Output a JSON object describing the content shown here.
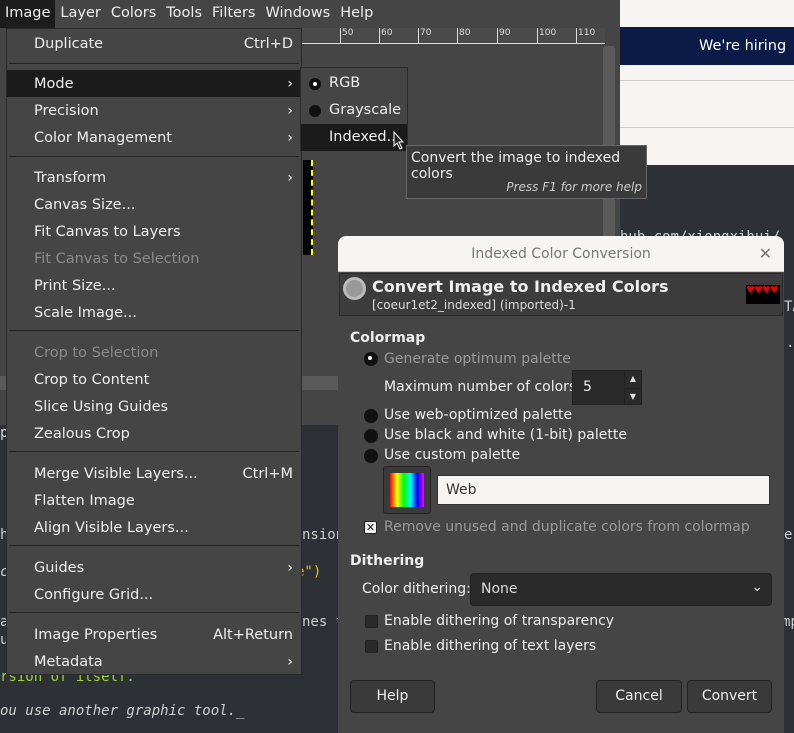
{
  "menubar": [
    "Image",
    "Layer",
    "Colors",
    "Tools",
    "Filters",
    "Windows",
    "Help"
  ],
  "ruler": [
    "50",
    "60",
    "70",
    "80",
    "90",
    "100",
    "110"
  ],
  "browser": {
    "banner": "We're hiring"
  },
  "background_code": {
    "l1": "hub.com/xiongxihui/",
    "l2": "TA",
    "l3": ".",
    "l4": "p",
    "l5": "h",
    "l6": "nsion",
    "l7": "c",
    "l8": "e\")",
    "l9": "a",
    "l10": "nes t",
    "l11": "u",
    "l12": "rsion of itself.",
    "l13": "ou use another graphic tool._",
    "l14": "e",
    "l15": "mp"
  },
  "image_menu": [
    {
      "label": "Duplicate",
      "shortcut": "Ctrl+D"
    },
    {
      "label": "Mode"
    },
    {
      "label": "Precision"
    },
    {
      "label": "Color Management"
    },
    {
      "label": "Transform"
    },
    {
      "label": "Canvas Size..."
    },
    {
      "label": "Fit Canvas to Layers"
    },
    {
      "label": "Fit Canvas to Selection"
    },
    {
      "label": "Print Size..."
    },
    {
      "label": "Scale Image..."
    },
    {
      "label": "Crop to Selection"
    },
    {
      "label": "Crop to Content"
    },
    {
      "label": "Slice Using Guides"
    },
    {
      "label": "Zealous Crop"
    },
    {
      "label": "Merge Visible Layers...",
      "shortcut": "Ctrl+M"
    },
    {
      "label": "Flatten Image"
    },
    {
      "label": "Align Visible Layers..."
    },
    {
      "label": "Guides"
    },
    {
      "label": "Configure Grid..."
    },
    {
      "label": "Image Properties",
      "shortcut": "Alt+Return"
    },
    {
      "label": "Metadata"
    }
  ],
  "mode_submenu": [
    {
      "label": "RGB",
      "selected": true
    },
    {
      "label": "Grayscale"
    },
    {
      "label": "Indexed..."
    }
  ],
  "tooltip": {
    "text": "Convert the image to indexed colors",
    "help": "Press F1 for more help"
  },
  "dialog": {
    "title": "Indexed Color Conversion",
    "heading": "Convert Image to Indexed Colors",
    "subheading": "[coeur1et2_indexed] (imported)-1",
    "colormap_label": "Colormap",
    "opt_generate": "Generate optimum palette",
    "max_colors_label": "Maximum number of colors:",
    "max_colors": "5",
    "opt_web": "Use web-optimized palette",
    "opt_bw": "Use black and white (1-bit) palette",
    "opt_custom": "Use custom palette",
    "palette_name": "Web",
    "remove_unused": "Remove unused and duplicate colors from colormap",
    "dithering_label": "Dithering",
    "color_dithering_label": "Color dithering:",
    "color_dithering": "None",
    "dither_transparency": "Enable dithering of transparency",
    "dither_text": "Enable dithering of text layers",
    "help": "Help",
    "cancel": "Cancel",
    "convert": "Convert"
  }
}
